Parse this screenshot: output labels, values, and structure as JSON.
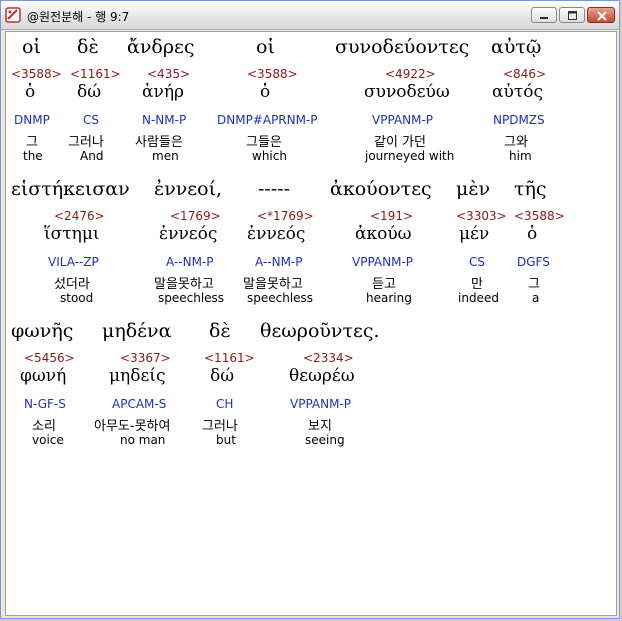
{
  "window": {
    "title": "@원전분해 - 행 9:7"
  },
  "lines": [
    {
      "words": [
        {
          "greek": "οἱ",
          "num": "<3588>",
          "lemma": "ὁ",
          "parse": "DNMP",
          "kor": "그",
          "eng": "the"
        },
        {
          "greek": "δὲ",
          "num": "<1161>",
          "lemma": "δώ",
          "parse": "CS",
          "kor": "그러나",
          "eng": "And"
        },
        {
          "greek": "ἄνδρες",
          "num": "<435>",
          "lemma": "ἀνήρ",
          "parse": "N-NM-P",
          "kor": "사람들은",
          "eng": "men"
        },
        {
          "greek": "οἱ",
          "num": "<3588>",
          "lemma": "ὁ",
          "parse": "DNMP#APRNM-P",
          "kor": "그들은",
          "eng": "which"
        },
        {
          "greek": "συνοδεύοντες",
          "num": "<4922>",
          "lemma": "συνοδεύω",
          "parse": "VPPANM-P",
          "kor": "같이 가던",
          "eng": "journeyed with"
        },
        {
          "greek": "αὐτῷ",
          "num": "<846>",
          "lemma": "αὐτός",
          "parse": "NPDMZS",
          "kor": "그와",
          "eng": "him"
        }
      ]
    },
    {
      "words": [
        {
          "greek": "εἱστήκεισαν",
          "num": "<2476>",
          "lemma": "ἵστημι",
          "parse": "VILA--ZP",
          "kor": "섰더라",
          "eng": "stood"
        },
        {
          "greek": "ἐννεοί,",
          "num": "<1769>",
          "lemma": "ἐννεός",
          "parse": "A--NM-P",
          "kor": "말을못하고",
          "eng": "speechless"
        },
        {
          "greek": "-----",
          "num": "<*1769>",
          "lemma": "ἐννεός",
          "parse": "A--NM-P",
          "kor": "말을못하고",
          "eng": "speechless"
        },
        {
          "greek": "ἀκούοντες",
          "num": "<191>",
          "lemma": "ἀκούω",
          "parse": "VPPANM-P",
          "kor": "듣고",
          "eng": "hearing"
        },
        {
          "greek": "μὲν",
          "num": "<3303>",
          "lemma": "μέν",
          "parse": "CS",
          "kor": "만",
          "eng": "indeed"
        },
        {
          "greek": "τῆς",
          "num": "<3588>",
          "lemma": "ὁ",
          "parse": "DGFS",
          "kor": "그",
          "eng": "a"
        }
      ]
    },
    {
      "words": [
        {
          "greek": "φωνῆς",
          "num": "<5456>",
          "lemma": "φωνή",
          "parse": "N-GF-S",
          "kor": "소리",
          "eng": "voice"
        },
        {
          "greek": "μηδένα",
          "num": "<3367>",
          "lemma": "μηδείς",
          "parse": "APCAM-S",
          "kor": "아무도-못하여",
          "eng": "no man"
        },
        {
          "greek": "δὲ",
          "num": "<1161>",
          "lemma": "δώ",
          "parse": "CH",
          "kor": "그러나",
          "eng": "but"
        },
        {
          "greek": "θεωροῦντες.",
          "num": "<2334>",
          "lemma": "θεωρέω",
          "parse": "VPPANM-P",
          "kor": "보지",
          "eng": "seeing"
        }
      ]
    }
  ],
  "colors": {
    "number": "#8b1a1a",
    "parse": "#1f2fbf"
  }
}
